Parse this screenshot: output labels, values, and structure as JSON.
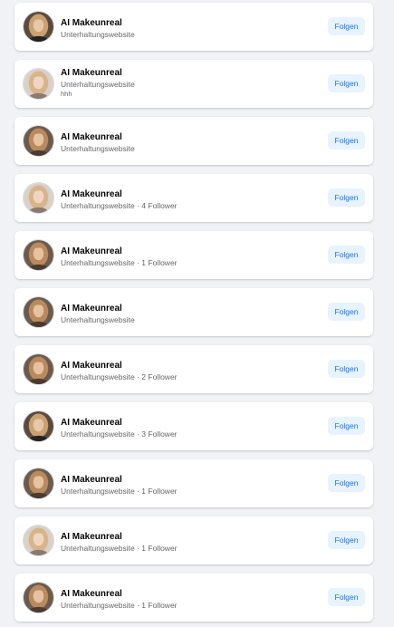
{
  "colors": {
    "page_bg": "#f0f2f5",
    "card_bg": "#ffffff",
    "button_bg": "#e7f3ff",
    "button_text": "#1b74e4",
    "secondary_text": "#65676b"
  },
  "items": [
    {
      "name": "AI Makeunreal",
      "category": "Unterhaltungswebsite",
      "extra": "",
      "button": "Folgen",
      "avatar_icon": "profile-photo",
      "avatar_variant": "dark"
    },
    {
      "name": "AI Makeunreal",
      "category": "Unterhaltungswebsite",
      "extra": "hhh",
      "button": "Folgen",
      "avatar_icon": "profile-photo",
      "avatar_variant": "light"
    },
    {
      "name": "AI Makeunreal",
      "category": "Unterhaltungswebsite",
      "extra": "",
      "button": "Folgen",
      "avatar_icon": "profile-photo",
      "avatar_variant": "warm"
    },
    {
      "name": "AI Makeunreal",
      "category": "Unterhaltungswebsite · 4 Follower",
      "extra": "",
      "button": "Folgen",
      "avatar_icon": "profile-photo",
      "avatar_variant": "light"
    },
    {
      "name": "AI Makeunreal",
      "category": "Unterhaltungswebsite · 1 Follower",
      "extra": "",
      "button": "Folgen",
      "avatar_icon": "profile-photo",
      "avatar_variant": "warm"
    },
    {
      "name": "AI Makeunreal",
      "category": "Unterhaltungswebsite",
      "extra": "",
      "button": "Folgen",
      "avatar_icon": "profile-photo",
      "avatar_variant": "warm"
    },
    {
      "name": "AI Makeunreal",
      "category": "Unterhaltungswebsite · 2 Follower",
      "extra": "",
      "button": "Folgen",
      "avatar_icon": "profile-photo",
      "avatar_variant": "warm"
    },
    {
      "name": "AI Makeunreal",
      "category": "Unterhaltungswebsite · 3 Follower",
      "extra": "",
      "button": "Folgen",
      "avatar_icon": "profile-photo",
      "avatar_variant": "dark"
    },
    {
      "name": "AI Makeunreal",
      "category": "Unterhaltungswebsite · 1 Follower",
      "extra": "",
      "button": "Folgen",
      "avatar_icon": "profile-photo",
      "avatar_variant": "warm"
    },
    {
      "name": "AI Makeunreal",
      "category": "Unterhaltungswebsite · 1 Follower",
      "extra": "",
      "button": "Folgen",
      "avatar_icon": "profile-photo",
      "avatar_variant": "light"
    },
    {
      "name": "AI Makeunreal",
      "category": "Unterhaltungswebsite · 1 Follower",
      "extra": "",
      "button": "Folgen",
      "avatar_icon": "profile-photo",
      "avatar_variant": "warm"
    }
  ]
}
